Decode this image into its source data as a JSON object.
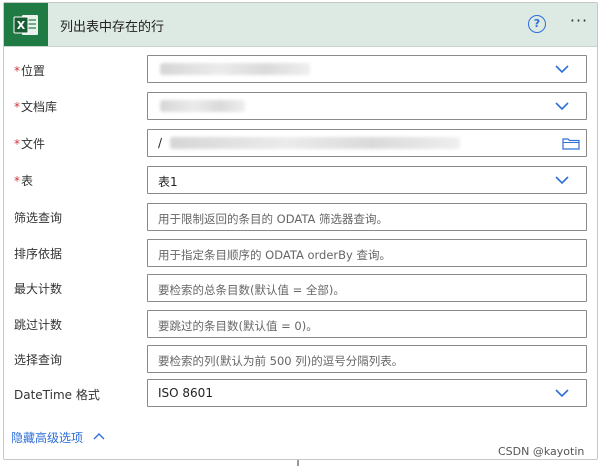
{
  "header": {
    "title": "列出表中存在的行",
    "help_label": "?",
    "more_label": "···",
    "app_icon": "excel-logo",
    "app_icon_letter": "X"
  },
  "fields": {
    "location": {
      "label": "位置",
      "required": true,
      "control": "dropdown",
      "value": ""
    },
    "document_library": {
      "label": "文档库",
      "required": true,
      "control": "dropdown",
      "value": ""
    },
    "file": {
      "label": "文件",
      "required": true,
      "control": "file-picker",
      "value": "/"
    },
    "table": {
      "label": "表",
      "required": true,
      "control": "dropdown",
      "value": "表1"
    },
    "filter_query": {
      "label": "筛选查询",
      "required": false,
      "control": "text",
      "placeholder": "用于限制返回的条目的 ODATA 筛选器查询。"
    },
    "order_by": {
      "label": "排序依据",
      "required": false,
      "control": "text",
      "placeholder": "用于指定条目顺序的 ODATA orderBy 查询。"
    },
    "top_count": {
      "label": "最大计数",
      "required": false,
      "control": "text",
      "placeholder": "要检索的总条目数(默认值 = 全部)。"
    },
    "skip_count": {
      "label": "跳过计数",
      "required": false,
      "control": "text",
      "placeholder": "要跳过的条目数(默认值 = 0)。"
    },
    "select_query": {
      "label": "选择查询",
      "required": false,
      "control": "text",
      "placeholder": "要检索的列(默认为前 500 列)的逗号分隔列表。"
    },
    "datetime_format": {
      "label": "DateTime 格式",
      "required": false,
      "control": "dropdown",
      "value": "ISO 8601"
    }
  },
  "required_marker": "*",
  "advanced": {
    "label": "隐藏高级选项"
  },
  "watermark": "CSDN @kayotin",
  "colors": {
    "header_bg": "#dde9e3",
    "excel_green": "#1f7a44",
    "link_blue": "#2f6fd8",
    "required_red": "#d13438"
  }
}
